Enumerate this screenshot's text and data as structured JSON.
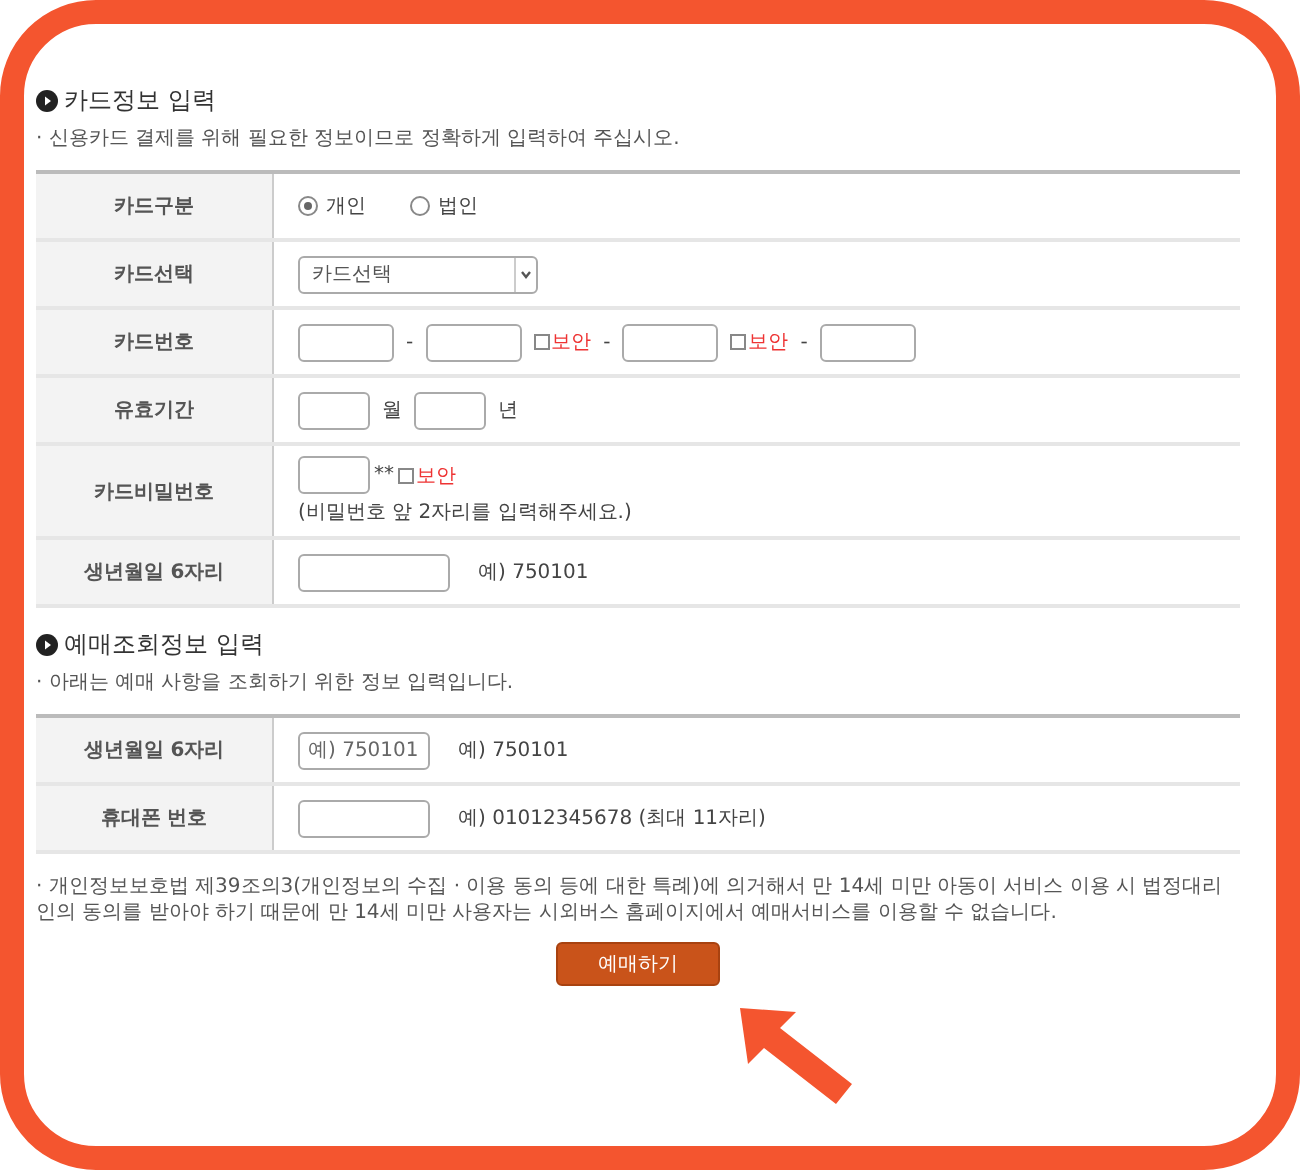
{
  "sections": [
    {
      "title": "카드정보 입력",
      "note": "· 신용카드 결제를 위해 필요한 정보이므로 정확하게 입력하여 주십시오.",
      "rows": [
        {
          "label": "카드구분",
          "kind": "radio",
          "options": [
            {
              "label": "개인",
              "selected": true
            },
            {
              "label": "법인",
              "selected": false
            }
          ]
        },
        {
          "label": "카드선택",
          "kind": "select",
          "value": "카드선택"
        },
        {
          "label": "카드번호",
          "kind": "card_number",
          "separator": "-",
          "fields": [
            {
              "kind": "plain"
            },
            {
              "kind": "secure",
              "secure_label": "보안",
              "checked": false
            },
            {
              "kind": "secure",
              "secure_label": "보안",
              "checked": false
            },
            {
              "kind": "plain"
            }
          ]
        },
        {
          "label": "유효기간",
          "kind": "expiry",
          "units": [
            "월",
            "년"
          ]
        },
        {
          "label": "카드비밀번호",
          "kind": "password",
          "mask": "**",
          "secure_label": "보안",
          "checked": false,
          "hint": "(비밀번호 앞 2자리를 입력해주세요.)"
        },
        {
          "label": "생년월일 6자리",
          "kind": "text",
          "example": "예) 750101"
        }
      ]
    },
    {
      "title": "예매조회정보 입력",
      "note": "· 아래는 예매 사항을 조회하기 위한 정보 입력입니다.",
      "rows": [
        {
          "label": "생년월일 6자리",
          "kind": "text",
          "placeholder": "예) 750101",
          "example": "예) 750101"
        },
        {
          "label": "휴대폰 번호",
          "kind": "text",
          "example": "예) 01012345678 (최대 11자리)"
        }
      ]
    }
  ],
  "footnote": "· 개인정보보호법 제39조의3(개인정보의 수집 · 이용 동의 등에 대한 특례)에 의거해서 만 14세 미만 아동이 서비스 이용 시 법정대리인의 동의를 받아야 하기 때문에 만 14세 미만 사용자는 시외버스 홈페이지에서 예매서비스를 이용할 수 없습니다.",
  "submit": "예매하기"
}
